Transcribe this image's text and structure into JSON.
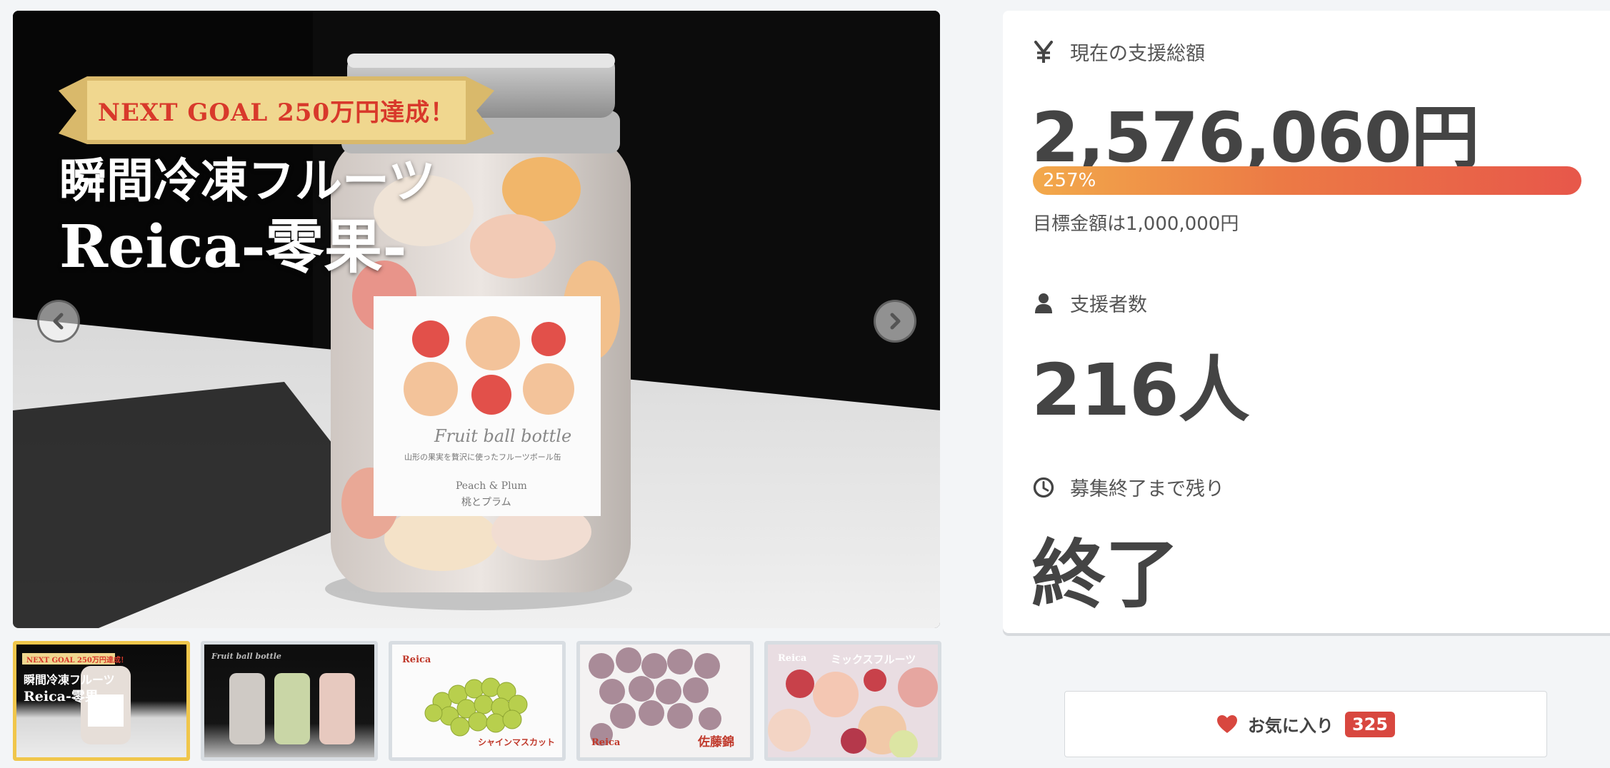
{
  "hero": {
    "banner": "NEXT GOAL 250万円達成！",
    "title_line1": "瞬間冷凍フルーツ",
    "title_line2": "Reica-零果-",
    "jar_label_script": "Fruit ball bottle",
    "jar_label_sub": "山形の果実を贅沢に使ったフルーツボール缶",
    "jar_label_en": "Peach & Plum",
    "jar_label_jp": "桃とプラム"
  },
  "thumbnails": [
    {
      "banner": "NEXT GOAL 250万円達成！",
      "line1": "瞬間冷凍フルーツ",
      "line2": "Reica-零果-"
    },
    {
      "caption": "Fruit ball bottle"
    },
    {
      "brand": "Reica",
      "caption": "シャインマスカット"
    },
    {
      "brand": "Reica",
      "caption": "佐藤錦"
    },
    {
      "brand": "Reica",
      "caption": "ミックスフルーツ"
    }
  ],
  "stats": {
    "total_label": "現在の支援総額",
    "total_value": "2,576,060円",
    "progress_text": "257%",
    "progress_percent": 257,
    "goal_text": "目標金額は1,000,000円",
    "supporters_label": "支援者数",
    "supporters_value": "216人",
    "remaining_label": "募集終了まで残り",
    "remaining_value": "終了"
  },
  "favorite": {
    "label": "お気に入り",
    "count": "325"
  },
  "colors": {
    "accent_red": "#d8473f",
    "progress_start": "#f2a94b",
    "progress_end": "#e7574a",
    "thumb_active": "#f0c64b"
  },
  "icons": [
    "yen-icon",
    "user-icon",
    "clock-icon",
    "heart-icon",
    "chevron-left-icon",
    "chevron-right-icon"
  ]
}
